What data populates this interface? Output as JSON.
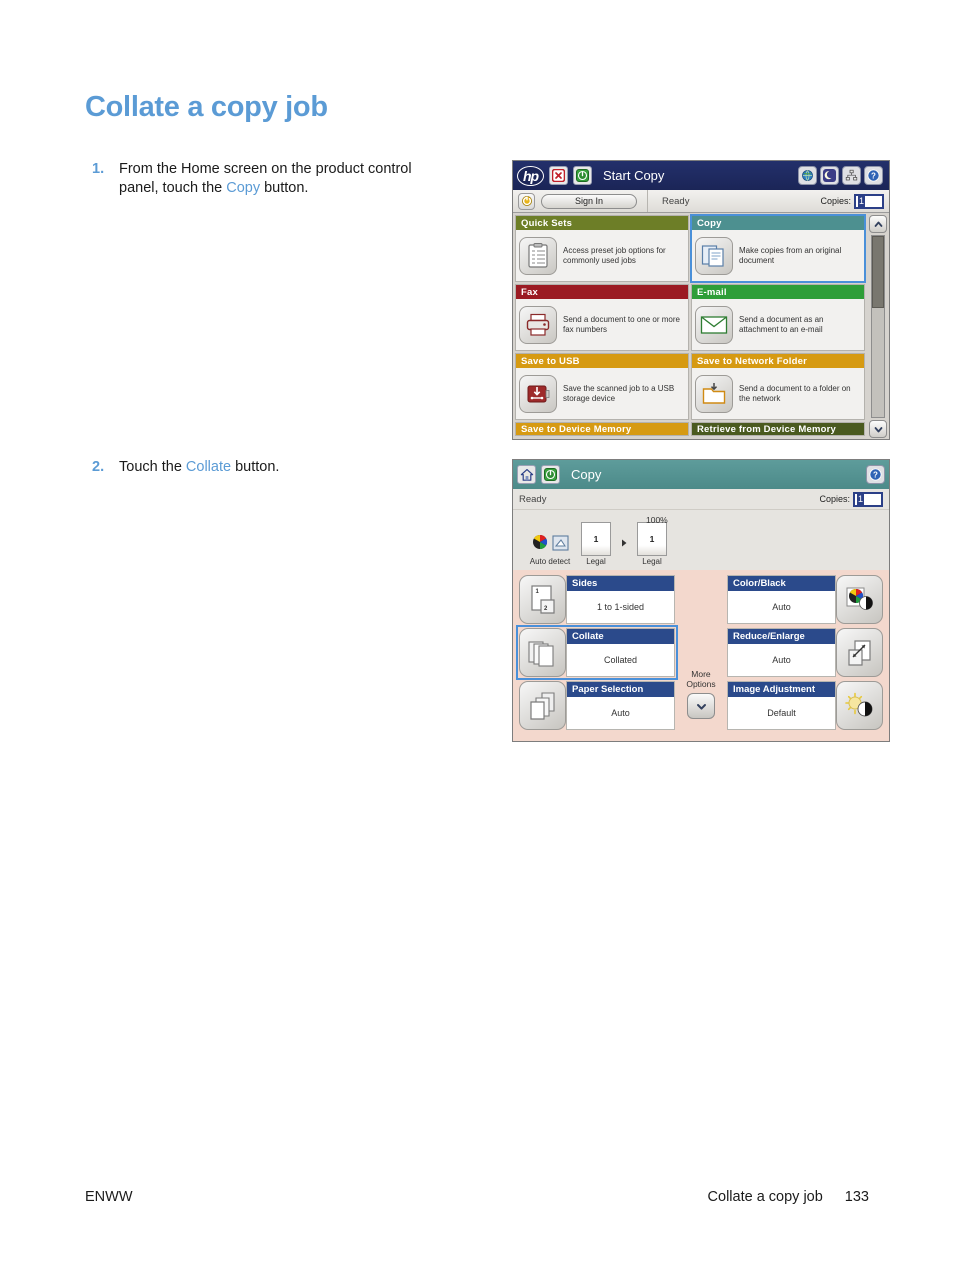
{
  "document": {
    "title": "Collate a copy job",
    "steps": [
      {
        "num": "1.",
        "text_before": "From the Home screen on the product control panel, touch the ",
        "highlight": "Copy",
        "text_after": " button."
      },
      {
        "num": "2.",
        "text_before": "Touch the ",
        "highlight": "Collate",
        "text_after": " button."
      }
    ],
    "footer": {
      "left": "ENWW",
      "section": "Collate a copy job",
      "page": "133"
    },
    "accent_color": "#5b9bd5"
  },
  "home_panel": {
    "header": {
      "logo": "hp",
      "title": "Start Copy",
      "stop_icon": "stop-icon",
      "start_icon": "start-icon",
      "icons": [
        "globe-icon",
        "sleep-icon",
        "network-icon",
        "help-icon"
      ],
      "background": "#23306b"
    },
    "subbar": {
      "power_icon": "power-icon",
      "sign_in_label": "Sign In",
      "status": "Ready",
      "copies_label": "Copies:",
      "copies_value": "1"
    },
    "tiles": [
      {
        "title": "Quick Sets",
        "desc": "Access preset job options for commonly used jobs",
        "color": "#6d7e27",
        "icon": "quick-sets-icon",
        "selected": false
      },
      {
        "title": "Copy",
        "desc": "Make copies from an original document",
        "color": "#4d9090",
        "icon": "copy-icon",
        "selected": true
      },
      {
        "title": "Fax",
        "desc": "Send a document to one or more fax numbers",
        "color": "#9b1b23",
        "icon": "fax-icon",
        "selected": false
      },
      {
        "title": "E-mail",
        "desc": "Send a document as an attachment to an e-mail",
        "color": "#2e9e38",
        "icon": "email-icon",
        "selected": false
      },
      {
        "title": "Save to USB",
        "desc": "Save the scanned job to a USB storage device",
        "color": "#d69a12",
        "icon": "usb-icon",
        "selected": false
      },
      {
        "title": "Save to Network Folder",
        "desc": "Send a document to a folder on the network",
        "color": "#d69a12",
        "icon": "network-folder-icon",
        "selected": false
      }
    ],
    "partial_tiles": [
      {
        "title": "Save to Device Memory",
        "color": "#d69a12"
      },
      {
        "title": "Retrieve from Device Memory",
        "color": "#4a5a1f"
      }
    ],
    "scrollbar": {
      "up_icon": "chevron-up-icon",
      "down_icon": "chevron-down-icon"
    }
  },
  "copy_panel": {
    "header": {
      "home_icon": "home-icon",
      "start_icon": "start-icon",
      "title": "Copy",
      "help_icon": "help-icon",
      "background": "#5e9c9b"
    },
    "status": {
      "text": "Ready",
      "copies_label": "Copies:",
      "copies_value": "1"
    },
    "preview": {
      "scan_icons": [
        "color-wheel-icon",
        "scan-icon"
      ],
      "scan_label": "Auto detect",
      "zoom": "100%",
      "source_page": {
        "number": "1",
        "size": "Legal"
      },
      "output_page": {
        "number": "1",
        "size": "Legal"
      },
      "arrow_icon": "arrow-right-icon"
    },
    "left_options": [
      {
        "title": "Sides",
        "value": "1 to 1-sided",
        "icon": "sides-icon",
        "selected": false
      },
      {
        "title": "Collate",
        "value": "Collated",
        "icon": "collate-icon",
        "selected": true
      },
      {
        "title": "Paper Selection",
        "value": "Auto",
        "icon": "paper-selection-icon",
        "selected": false
      }
    ],
    "right_options": [
      {
        "title": "Color/Black",
        "value": "Auto",
        "icon": "color-black-icon",
        "selected": false
      },
      {
        "title": "Reduce/Enlarge",
        "value": "Auto",
        "icon": "reduce-enlarge-icon",
        "selected": false
      },
      {
        "title": "Image Adjustment",
        "value": "Default",
        "icon": "image-adjustment-icon",
        "selected": false
      }
    ],
    "more_options": {
      "label_line1": "More",
      "label_line2": "Options",
      "icon": "chevron-down-icon"
    }
  }
}
